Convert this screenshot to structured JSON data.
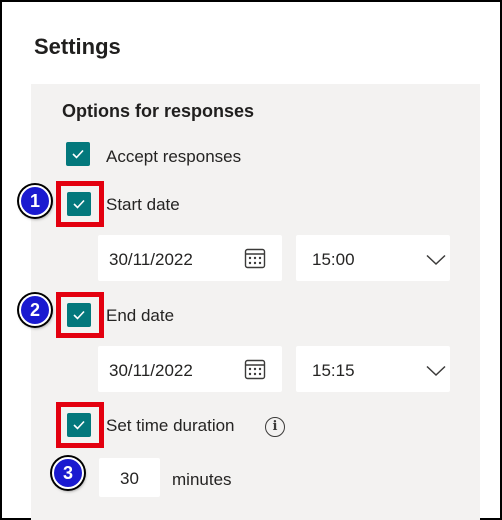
{
  "header": {
    "title": "Settings"
  },
  "options": {
    "section_title": "Options for responses",
    "accept_responses": {
      "label": "Accept responses",
      "checked": true
    },
    "start_date": {
      "label": "Start date",
      "checked": true,
      "date": "30/11/2022",
      "time": "15:00"
    },
    "end_date": {
      "label": "End date",
      "checked": true,
      "date": "30/11/2022",
      "time": "15:15"
    },
    "time_duration": {
      "label": "Set time duration",
      "checked": true,
      "value": "30",
      "unit": "minutes"
    }
  },
  "annotations": {
    "marker_1": "1",
    "marker_2": "2",
    "marker_3": "3",
    "highlight_color": "#e3000f",
    "marker_color": "#1a1ad0"
  },
  "colors": {
    "checkbox": "#03787c",
    "panel": "#f3f2f1"
  },
  "icons": {
    "calendar": "calendar-icon",
    "chevron": "chevron-down-icon",
    "info": "info-icon",
    "check": "checkmark-icon"
  }
}
